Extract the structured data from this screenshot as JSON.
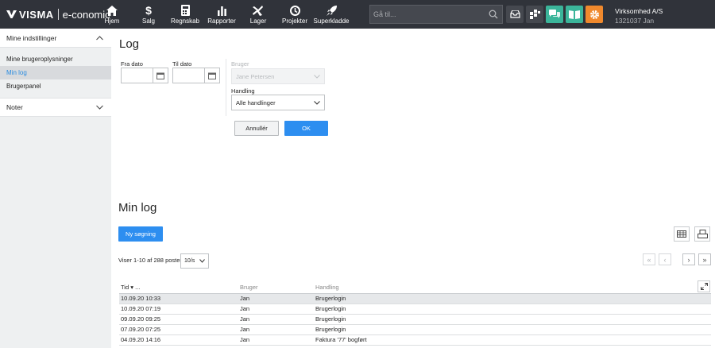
{
  "app": {
    "brand": "VISMA",
    "product": "e-conomic"
  },
  "nav": [
    {
      "label": "Hjem",
      "icon": "home-icon"
    },
    {
      "label": "Salg",
      "icon": "dollar-icon"
    },
    {
      "label": "Regnskab",
      "icon": "calculator-icon"
    },
    {
      "label": "Rapporter",
      "icon": "bar-chart-icon"
    },
    {
      "label": "Lager",
      "icon": "lager-icon"
    },
    {
      "label": "Projekter",
      "icon": "clock-icon"
    },
    {
      "label": "Superkladde",
      "icon": "rocket-icon"
    }
  ],
  "search": {
    "placeholder": "Gå til..."
  },
  "company": {
    "name": "Virksomhed A/S",
    "sub": "1321037 Jan"
  },
  "colors": {
    "topbar": "#30333a",
    "accent": "#2d8ef0",
    "teal": "#3bb59a",
    "orange": "#f0892d"
  },
  "sidebar": {
    "section1": "Mine indstillinger",
    "items": [
      "Mine brugeroplysninger",
      "Min log",
      "Brugerpanel"
    ],
    "section2": "Noter"
  },
  "log": {
    "title": "Log",
    "from_label": "Fra dato",
    "to_label": "Til dato",
    "user_label": "Bruger",
    "user_value": "Jane Petersen",
    "action_label": "Handling",
    "action_value": "Alle handlinger",
    "cancel": "Annullér",
    "ok": "OK"
  },
  "minlog": {
    "title": "Min log",
    "new_search": "Ny søgning",
    "info": "Viser 1-10 af 288 poster",
    "per_page": "10/s",
    "columns": [
      "Tid ▾ ...",
      "Bruger",
      "Handling"
    ],
    "rows": [
      [
        "10.09.20 10:33",
        "Jan",
        "Brugerlogin"
      ],
      [
        "10.09.20 07:19",
        "Jan",
        "Brugerlogin"
      ],
      [
        "09.09.20 09:25",
        "Jan",
        "Brugerlogin"
      ],
      [
        "07.09.20 07:25",
        "Jan",
        "Brugerlogin"
      ],
      [
        "04.09.20 14:16",
        "Jan",
        "Faktura '77' bogført"
      ]
    ]
  }
}
